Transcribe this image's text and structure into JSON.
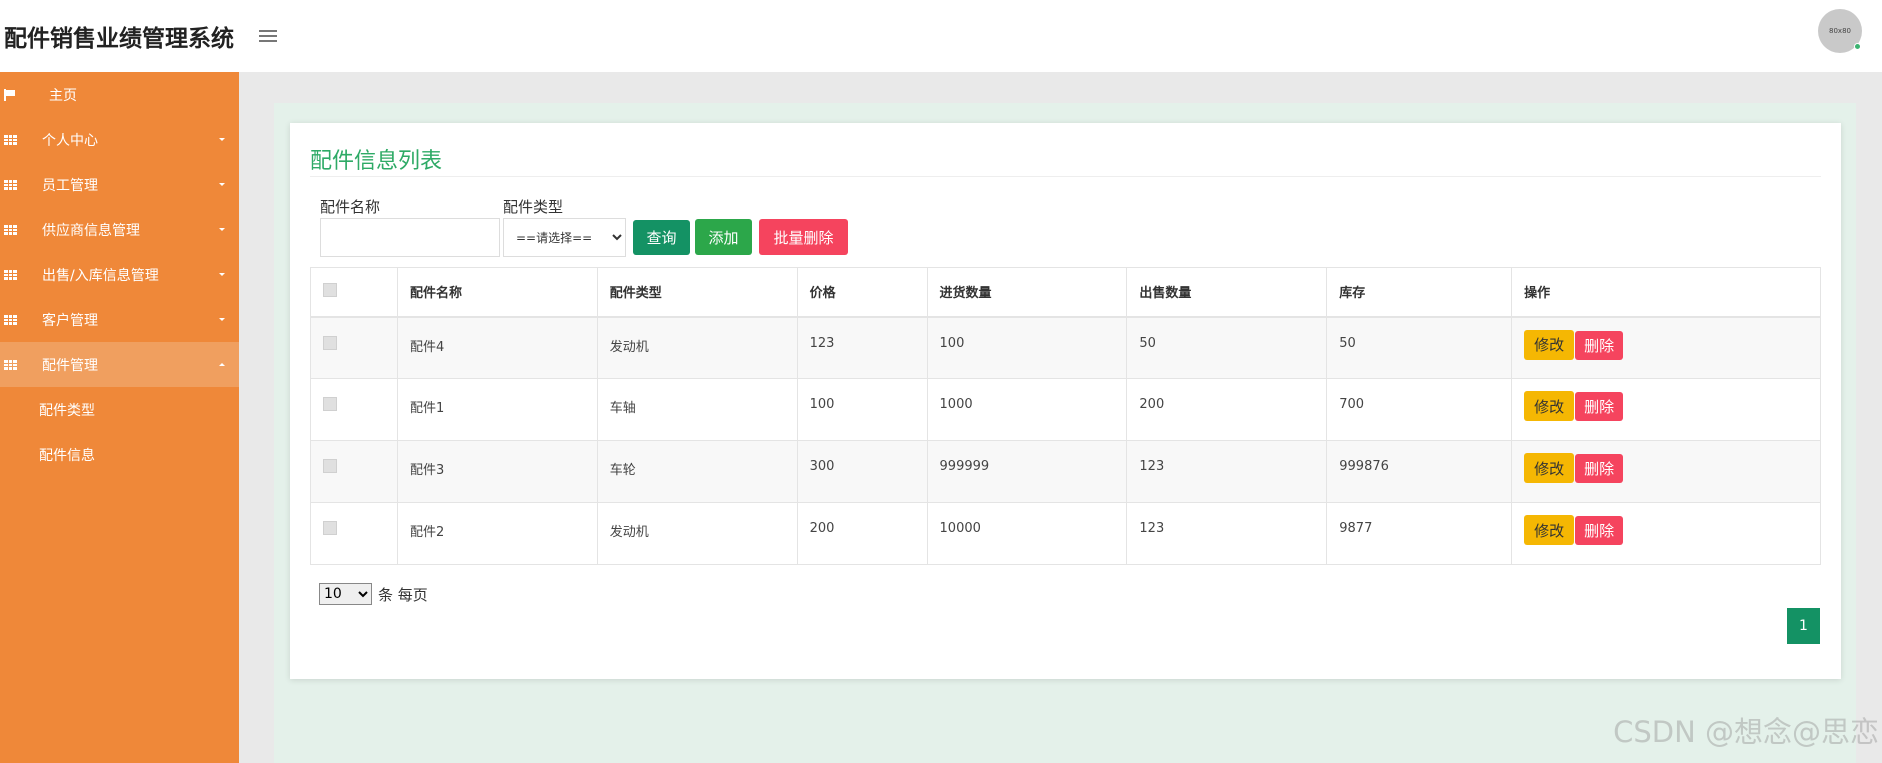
{
  "header": {
    "title": "配件销售业绩管理系统",
    "avatar_text": "80x80"
  },
  "sidebar": {
    "items": [
      {
        "label": "主页"
      },
      {
        "label": "个人中心"
      },
      {
        "label": "员工管理"
      },
      {
        "label": "供应商信息管理"
      },
      {
        "label": "出售/入库信息管理"
      },
      {
        "label": "客户管理"
      },
      {
        "label": "配件管理"
      }
    ],
    "sub_items": [
      {
        "label": "配件类型"
      },
      {
        "label": "配件信息"
      }
    ]
  },
  "main": {
    "title": "配件信息列表",
    "filters": {
      "name_label": "配件名称",
      "name_value": "",
      "type_label": "配件类型",
      "type_selected": "==请选择=="
    },
    "buttons": {
      "query": "查询",
      "add": "添加",
      "batch_delete": "批量删除"
    },
    "table": {
      "columns": [
        "配件名称",
        "配件类型",
        "价格",
        "进货数量",
        "出售数量",
        "库存",
        "操作"
      ],
      "rows": [
        {
          "name": "配件4",
          "type": "发动机",
          "price": "123",
          "purchase_qty": "100",
          "sold_qty": "50",
          "stock": "50"
        },
        {
          "name": "配件1",
          "type": "车轴",
          "price": "100",
          "purchase_qty": "1000",
          "sold_qty": "200",
          "stock": "700"
        },
        {
          "name": "配件3",
          "type": "车轮",
          "price": "300",
          "purchase_qty": "999999",
          "sold_qty": "123",
          "stock": "999876"
        },
        {
          "name": "配件2",
          "type": "发动机",
          "price": "200",
          "purchase_qty": "10000",
          "sold_qty": "123",
          "stock": "9877"
        }
      ],
      "edit_label": "修改",
      "delete_label": "删除"
    },
    "pagination": {
      "page_size": "10",
      "per_page_label": "条 每页",
      "current_page": "1"
    }
  },
  "watermark": "CSDN @想念@思恋",
  "colors": {
    "sidebar": "#ef8839",
    "accent_green": "#149264",
    "title_green": "#2eaa66",
    "danger": "#f5445e",
    "warning": "#f5b703"
  },
  "icons": {
    "menu": "hamburger-icon",
    "home": "flag-icon",
    "section": "grid-icon"
  }
}
